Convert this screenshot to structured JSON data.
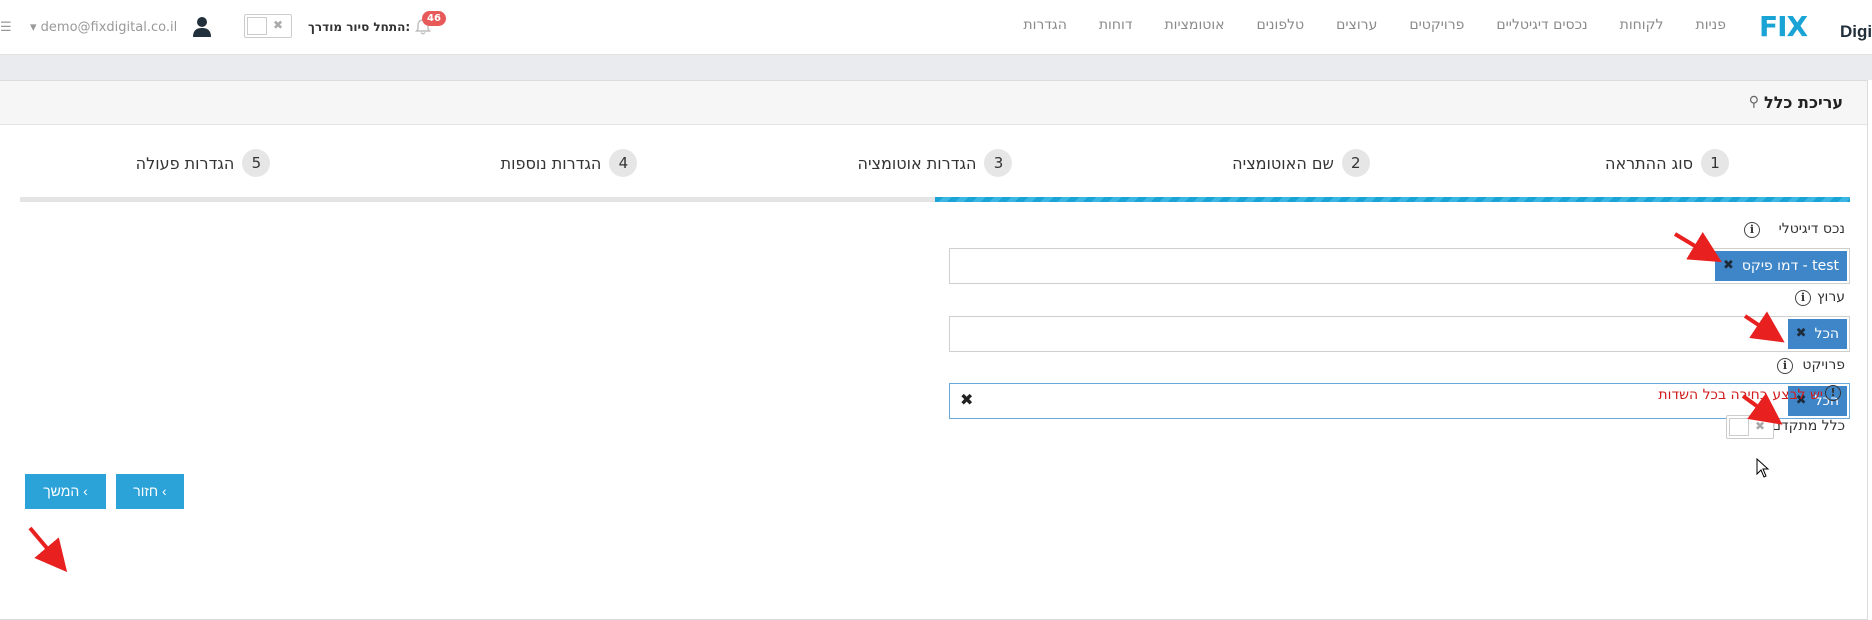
{
  "nav": {
    "logo_mark": "FIX",
    "logo_sub": "Digital",
    "links": [
      "פניות",
      "לקוחות",
      "נכסים דיגיטליים",
      "פרויקטים",
      "ערוצים",
      "טלפונים",
      "אוטומציות",
      "דוחות",
      "הגדרות"
    ],
    "notifications_count": "46",
    "tour_label": "התחל סיור מודרך:",
    "user_email": "demo@fixdigital.co.il"
  },
  "panel": {
    "title": "עריכת כלל"
  },
  "steps": [
    {
      "num": "1",
      "label": "סוג ההתראה"
    },
    {
      "num": "2",
      "label": "שם האוטומציה"
    },
    {
      "num": "3",
      "label": "הגדרות אוטומציה"
    },
    {
      "num": "4",
      "label": "הגדרות נוספות"
    },
    {
      "num": "5",
      "label": "הגדרות פעולה"
    }
  ],
  "active_step": 3,
  "form": {
    "digital_asset": {
      "label": "נכס דיגיטלי",
      "chip": "דמו פיקס - test"
    },
    "channel": {
      "label": "ערוץ",
      "chip": "הכל"
    },
    "project": {
      "label": "פרויקט",
      "chip": "הכל"
    },
    "error": "יש לבצע בחירה בכל השדות",
    "advanced_rule_label": "כלל מתקדם"
  },
  "buttons": {
    "next": "המשך ‹",
    "back": "חזור ‹"
  },
  "colors": {
    "accent": "#2ba3d8",
    "chip": "#3f86c8",
    "error": "#d01c1c",
    "badge": "#e85a5a",
    "annotation_arrow": "#e8201f"
  }
}
